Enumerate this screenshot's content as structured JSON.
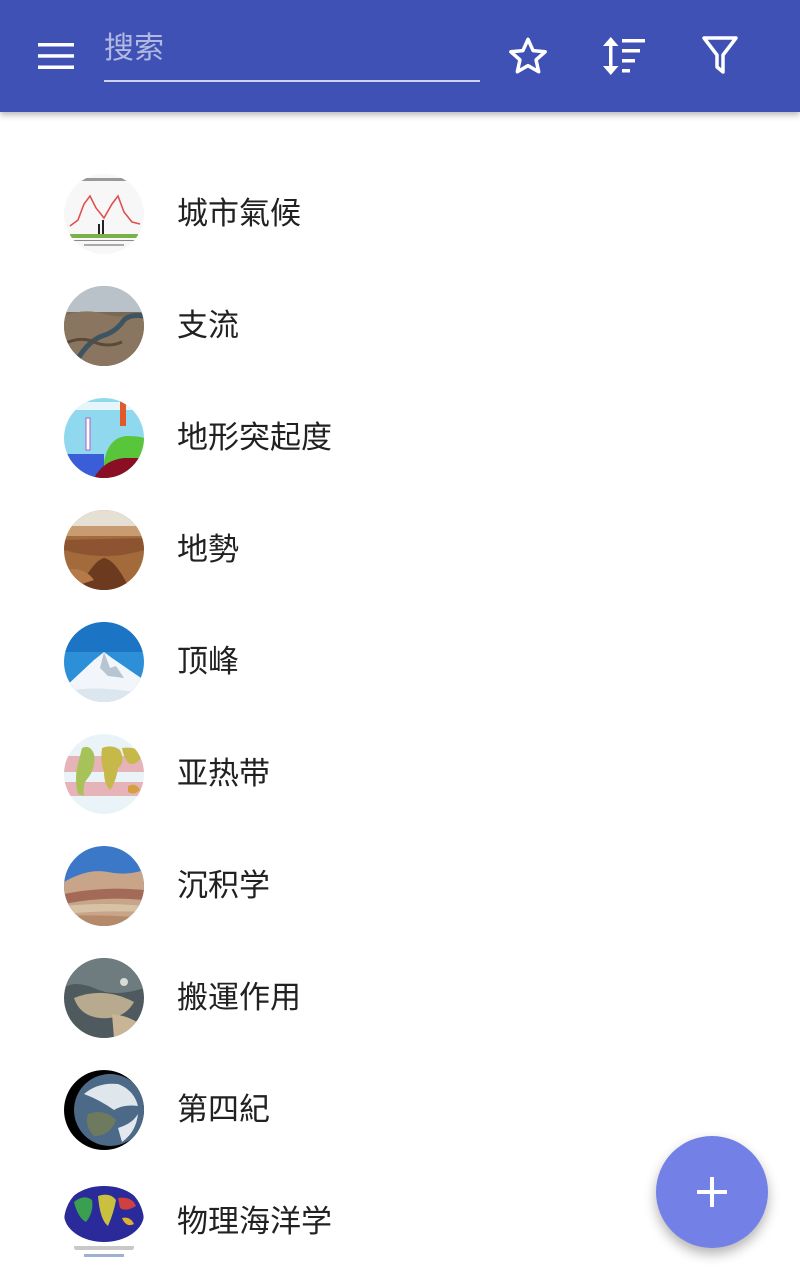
{
  "toolbar": {
    "search_placeholder": "搜索",
    "icons": {
      "menu": "hamburger-menu-icon",
      "favorites": "star-outline-icon",
      "sort": "sort-icon",
      "filter": "filter-icon"
    },
    "background_color": "#3f51b5"
  },
  "articles": [
    {
      "label": "城市氣候",
      "thumbnail": "urban-heat-island-chart"
    },
    {
      "label": "支流",
      "thumbnail": "river-confluence-aerial"
    },
    {
      "label": "地形突起度",
      "thumbnail": "topographic-prominence-diagram"
    },
    {
      "label": "地勢",
      "thumbnail": "canyon-relief"
    },
    {
      "label": "顶峰",
      "thumbnail": "snowy-peak"
    },
    {
      "label": "亚热带",
      "thumbnail": "world-map-subtropics"
    },
    {
      "label": "沉积学",
      "thumbnail": "sediment-layers"
    },
    {
      "label": "搬運作用",
      "thumbnail": "dust-storm-satellite"
    },
    {
      "label": "第四紀",
      "thumbnail": "earth-globe"
    },
    {
      "label": "物理海洋学",
      "thumbnail": "ocean-floor-map"
    }
  ],
  "fab": {
    "icon": "plus-icon",
    "color": "#7380e6"
  }
}
